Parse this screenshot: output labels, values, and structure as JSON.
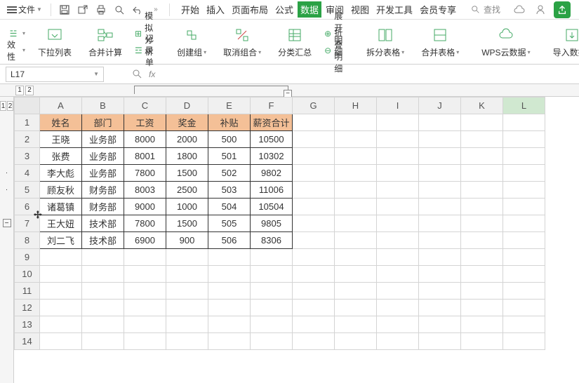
{
  "topbar": {
    "file_label": "文件",
    "tabs": [
      "开始",
      "插入",
      "页面布局",
      "公式",
      "数据",
      "审阅",
      "视图",
      "开发工具",
      "会员专享"
    ],
    "active_tab": 4,
    "search_label": "查找"
  },
  "ribbon": {
    "validity": "效性",
    "dropdown_list": "下拉列表",
    "consolidate": "合并计算",
    "simulate": "模拟分析",
    "record": "记录单",
    "group": "创建组",
    "ungroup": "取消组合",
    "subtotal": "分类汇总",
    "show_detail": "展开明细",
    "hide_detail": "折叠明细",
    "split_table": "拆分表格",
    "merge_table": "合并表格",
    "wps_cloud": "WPS云数据",
    "import_data": "导入数据"
  },
  "namebox": "L17",
  "outline": {
    "levels": [
      "1",
      "2"
    ],
    "row_levels": [
      "1",
      "2"
    ]
  },
  "columns": [
    "A",
    "B",
    "C",
    "D",
    "E",
    "F",
    "G",
    "H",
    "I",
    "J",
    "K",
    "L"
  ],
  "selected_col": 11,
  "rows": [
    "1",
    "2",
    "3",
    "4",
    "5",
    "6",
    "7",
    "8",
    "9",
    "10",
    "11",
    "12",
    "13",
    "14"
  ],
  "headers": [
    "姓名",
    "部门",
    "工资",
    "奖金",
    "补贴",
    "薪资合计"
  ],
  "data": [
    [
      "王晓",
      "业务部",
      "8000",
      "2000",
      "500",
      "10500"
    ],
    [
      "张费",
      "业务部",
      "8001",
      "1800",
      "501",
      "10302"
    ],
    [
      "李大彪",
      "业务部",
      "7800",
      "1500",
      "502",
      "9802"
    ],
    [
      "顾友秋",
      "财务部",
      "8003",
      "2500",
      "503",
      "11006"
    ],
    [
      "诸葛镇",
      "财务部",
      "9000",
      "1000",
      "504",
      "10504"
    ],
    [
      "王大妞",
      "技术部",
      "7800",
      "1500",
      "505",
      "9805"
    ],
    [
      "刘二飞",
      "技术部",
      "6900",
      "900",
      "506",
      "8306"
    ]
  ]
}
